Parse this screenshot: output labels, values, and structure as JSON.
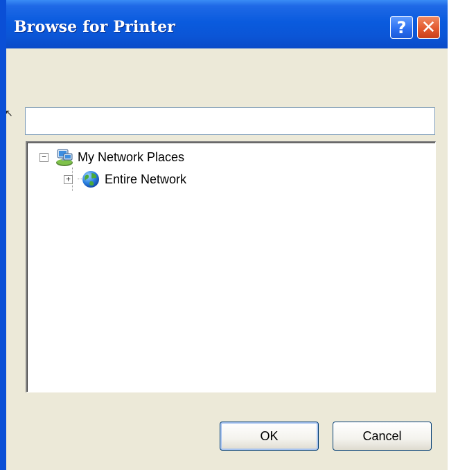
{
  "window": {
    "title": "Browse for Printer",
    "help_button_label": "?",
    "close_button_label": "✕"
  },
  "path_field": {
    "value": "",
    "placeholder": ""
  },
  "tree": {
    "items": [
      {
        "label": "My Network Places",
        "expander": "−",
        "icon": "network-places-icon"
      },
      {
        "label": "Entire Network",
        "expander": "+",
        "icon": "globe-icon"
      }
    ]
  },
  "buttons": {
    "ok_label": "OK",
    "cancel_label": "Cancel"
  },
  "colors": {
    "titlebar": "#0a5bde",
    "dialog_background": "#ece9d8",
    "close_button": "#e35a2f",
    "help_button": "#2a6ef0"
  }
}
